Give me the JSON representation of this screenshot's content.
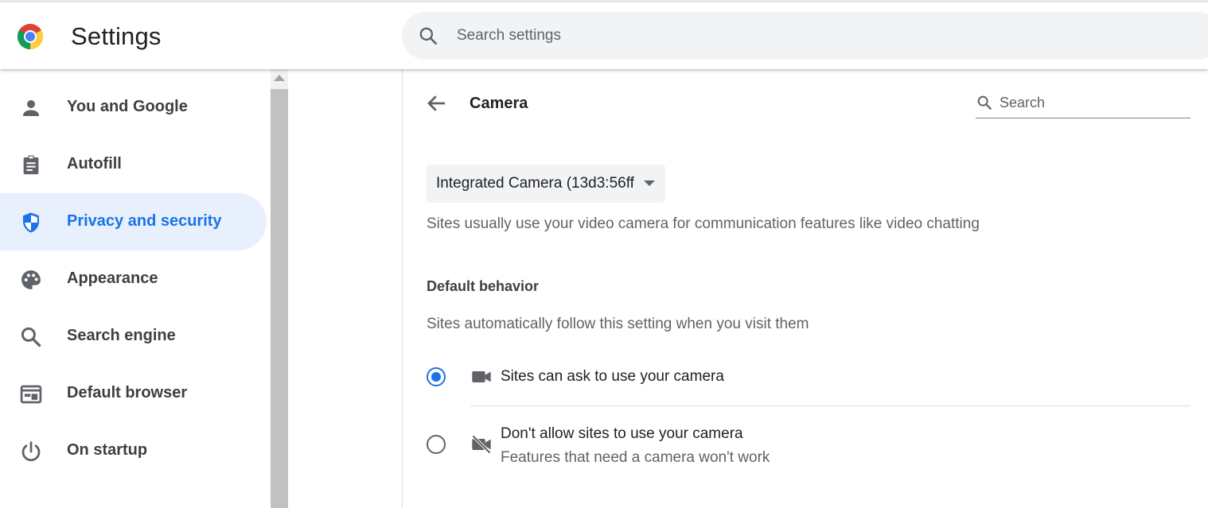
{
  "header": {
    "app_title": "Settings",
    "search_placeholder": "Search settings"
  },
  "sidebar": {
    "items": [
      {
        "label": "You and Google",
        "icon": "person-icon"
      },
      {
        "label": "Autofill",
        "icon": "clipboard-icon"
      },
      {
        "label": "Privacy and security",
        "icon": "shield-icon",
        "selected": true
      },
      {
        "label": "Appearance",
        "icon": "palette-icon"
      },
      {
        "label": "Search engine",
        "icon": "search-icon"
      },
      {
        "label": "Default browser",
        "icon": "browser-window-icon"
      },
      {
        "label": "On startup",
        "icon": "power-icon"
      }
    ]
  },
  "main": {
    "title": "Camera",
    "search_placeholder": "Search",
    "device_select_value": "Integrated Camera (13d3:56ff",
    "description": "Sites usually use your video camera for communication features like video chatting",
    "default_behavior": {
      "heading": "Default behavior",
      "subheading": "Sites automatically follow this setting when you visit them",
      "options": [
        {
          "label": "Sites can ask to use your camera",
          "icon": "videocam-icon",
          "checked": true
        },
        {
          "label": "Don't allow sites to use your camera",
          "sublabel": "Features that need a camera won't work",
          "icon": "videocam-off-icon",
          "checked": false
        }
      ]
    }
  },
  "colors": {
    "accent": "#1a73e8",
    "selected_bg": "#e8f0fe",
    "secondary_text": "#5f6368"
  }
}
